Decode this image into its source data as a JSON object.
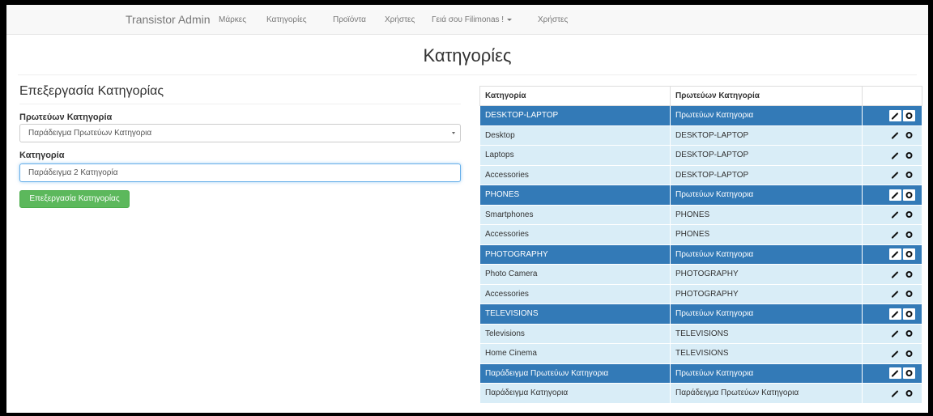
{
  "navbar": {
    "brand": "Transistor Admin",
    "items": [
      "Μάρκες",
      "Κατηγορίες",
      "Προϊόντα",
      "Χρήστες"
    ],
    "user_menu": "Γειά σου Filimonas !",
    "extra": "Χρήστες"
  },
  "page_title": "Κατηγορίες",
  "form": {
    "title": "Επεξεργασία Κατηγορίας",
    "parent_label": "Πρωτεύων Κατηγορία",
    "parent_value": "Παράδειγμα Πρωτεύων Κατηγορια",
    "category_label": "Κατηγορία",
    "category_value": "Παράδειγμα 2 Κατηγορία",
    "submit_label": "Επεξεργασία Κατηγορίας"
  },
  "table": {
    "headers": [
      "Κατηγορία",
      "Πρωτεύων Κατηγορία",
      ""
    ],
    "rows": [
      {
        "name": "DESKTOP-LAPTOP",
        "parent": "Πρωτεύων Κατηγορια",
        "type": "parent"
      },
      {
        "name": "Desktop",
        "parent": "DESKTOP-LAPTOP",
        "type": "child"
      },
      {
        "name": "Laptops",
        "parent": "DESKTOP-LAPTOP",
        "type": "child"
      },
      {
        "name": "Accessories",
        "parent": "DESKTOP-LAPTOP",
        "type": "child"
      },
      {
        "name": "PHONES",
        "parent": "Πρωτεύων Κατηγορια",
        "type": "parent"
      },
      {
        "name": "Smartphones",
        "parent": "PHONES",
        "type": "child"
      },
      {
        "name": "Accessories",
        "parent": "PHONES",
        "type": "child"
      },
      {
        "name": "PHOTOGRAPHY",
        "parent": "Πρωτεύων Κατηγορια",
        "type": "parent"
      },
      {
        "name": "Photo Camera",
        "parent": "PHOTOGRAPHY",
        "type": "child"
      },
      {
        "name": "Accessories",
        "parent": "PHOTOGRAPHY",
        "type": "child"
      },
      {
        "name": "TELEVISIONS",
        "parent": "Πρωτεύων Κατηγορια",
        "type": "parent"
      },
      {
        "name": "Televisions",
        "parent": "TELEVISIONS",
        "type": "child"
      },
      {
        "name": "Home Cinema",
        "parent": "TELEVISIONS",
        "type": "child"
      },
      {
        "name": "Παράδειγμα Πρωτεύων Κατηγορια",
        "parent": "Πρωτεύων Κατηγορια",
        "type": "parent"
      },
      {
        "name": "Παράδειγμα Κατηγορια",
        "parent": "Παράδειγμα Πρωτεύων Κατηγορια",
        "type": "child"
      }
    ],
    "row_actions": [
      "edit-icon",
      "delete-icon"
    ]
  },
  "colors": {
    "parent_row": "#337ab7",
    "child_row": "#d9edf7",
    "submit_button": "#5cb85c"
  }
}
